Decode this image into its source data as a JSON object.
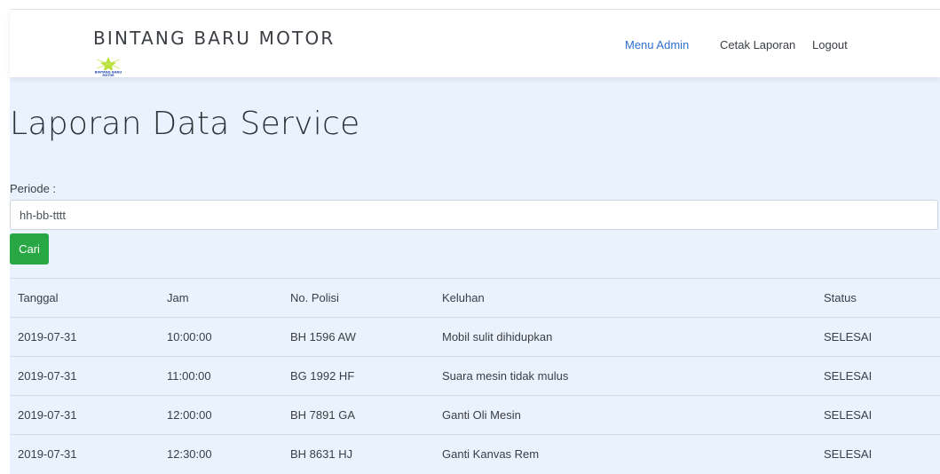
{
  "navbar": {
    "brand": "BINTANG BARU MOTOR",
    "logo_text": "BINTANG BARU MOTOR",
    "links": [
      {
        "label": "Menu Admin",
        "active": true
      },
      {
        "label": "Cetak Laporan",
        "active": false
      },
      {
        "label": "Logout",
        "active": false
      }
    ]
  },
  "page": {
    "title": "Laporan Data Service",
    "periode_label": "Periode :",
    "periode_placeholder": "hh-bb-tttt",
    "search_button": "Cari"
  },
  "table": {
    "headers": [
      "Tanggal",
      "Jam",
      "No. Polisi",
      "Keluhan",
      "Status"
    ],
    "rows": [
      [
        "2019-07-31",
        "10:00:00",
        "BH 1596 AW",
        "Mobil sulit dihidupkan",
        "SELESAI"
      ],
      [
        "2019-07-31",
        "11:00:00",
        "BG 1992 HF",
        "Suara mesin tidak mulus",
        "SELESAI"
      ],
      [
        "2019-07-31",
        "12:00:00",
        "BH 7891 GA",
        "Ganti Oli Mesin",
        "SELESAI"
      ],
      [
        "2019-07-31",
        "12:30:00",
        "BH 8631 HJ",
        "Ganti Kanvas Rem",
        "SELESAI"
      ]
    ]
  },
  "colors": {
    "nav_active": "#2e6fd0",
    "content_bg": "#e9f2fd",
    "button_green": "#28a745",
    "logo_star": "#b7e03a",
    "logo_text": "#2a4fb3"
  }
}
